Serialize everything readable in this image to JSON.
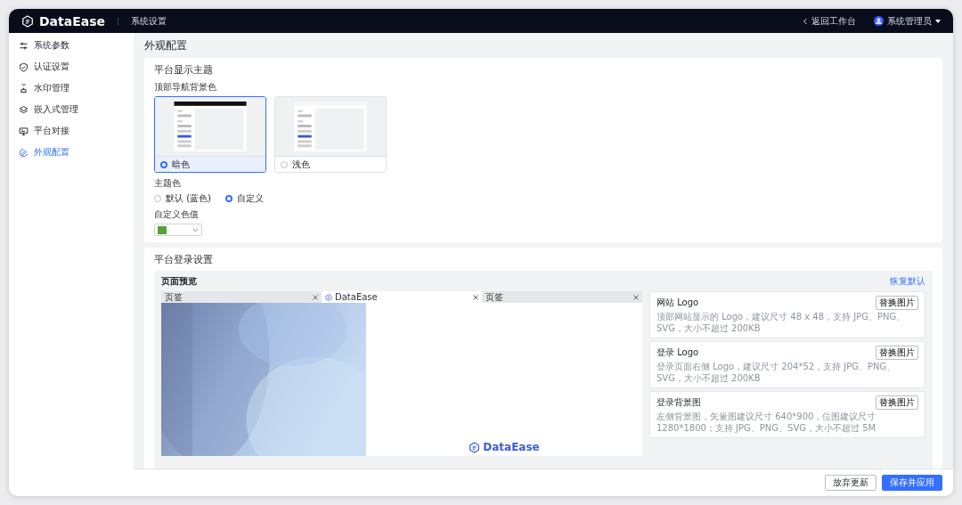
{
  "header": {
    "brand": "DataEase",
    "section": "系统设置",
    "back_link": "返回工作台",
    "user": "系统管理员"
  },
  "sidebar": {
    "items": [
      {
        "label": "系统参数",
        "selected": false
      },
      {
        "label": "认证设置",
        "selected": false
      },
      {
        "label": "水印管理",
        "selected": false
      },
      {
        "label": "嵌入式管理",
        "selected": false
      },
      {
        "label": "平台对接",
        "selected": false
      },
      {
        "label": "外观配置",
        "selected": true
      }
    ]
  },
  "page_title": "外观配置",
  "theme_section": {
    "title": "平台显示主题",
    "nav_bg_label": "顶部导航背景色",
    "nav_options": [
      {
        "label": "暗色",
        "kind": "dark",
        "selected": true
      },
      {
        "label": "浅色",
        "kind": "light",
        "selected": false
      }
    ],
    "theme_color_label": "主题色",
    "theme_color_options": [
      {
        "label": "默认 (蓝色)",
        "selected": false
      },
      {
        "label": "自定义",
        "selected": true
      }
    ],
    "custom_color_label": "自定义色值",
    "custom_color": {
      "color": "#5a9e3a"
    }
  },
  "login_section": {
    "title": "平台登录设置",
    "preview_label": "页面预览",
    "reset_link": "恢复默认",
    "browser_tabs": [
      {
        "label": "页签",
        "selected": false
      },
      {
        "label": "DataEase",
        "selected": true
      },
      {
        "label": "页签",
        "selected": false
      }
    ],
    "login_logo": "DataEase",
    "assets": [
      {
        "title": "网站 Logo",
        "button": "替换图片",
        "hint": "顶部网站显示的 Logo，建议尺寸 48 x 48，支持 JPG、PNG、SVG，大小不超过 200KB"
      },
      {
        "title": "登录 Logo",
        "button": "替换图片",
        "hint": "登录页面右侧 Logo，建议尺寸 204*52，支持 JPG、PNG、SVG，大小不超过 200KB"
      },
      {
        "title": "登录背景图",
        "button": "替换图片",
        "hint": "左侧背景图，矢量图建议尺寸 640*900，位图建议尺寸 1280*1800；支持 JPG、PNG、SVG，大小不超过 5M"
      }
    ]
  },
  "footer": {
    "buttons": [
      {
        "label": "放弃更新",
        "kind": "secondary"
      },
      {
        "label": "保存并应用",
        "kind": "primary"
      }
    ]
  }
}
